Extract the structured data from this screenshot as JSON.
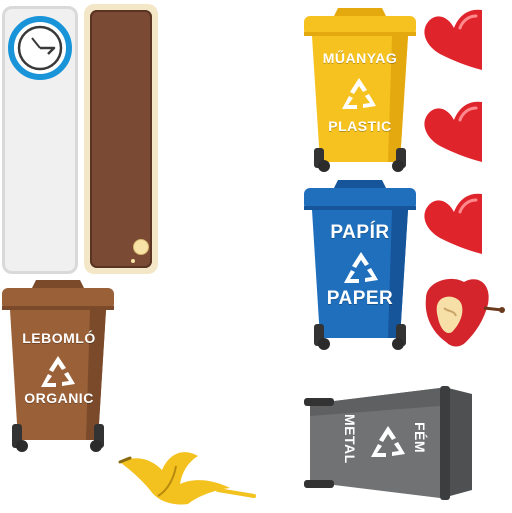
{
  "colors": {
    "plastic": "#f6c220",
    "paper": "#1f6fbd",
    "organic": "#9a6038",
    "metal": "#6f7172",
    "heart": "#e0242c"
  },
  "bins": {
    "plastic": {
      "line1": "MŰANYAG",
      "line2": "PLASTIC"
    },
    "paper": {
      "line1": "PAPÍR",
      "line2": "PAPER"
    },
    "organic": {
      "line1": "LEBOMLÓ",
      "line2": "ORGANIC"
    },
    "metal": {
      "line1": "FÉM",
      "line2": "METAL"
    }
  },
  "hud": {
    "timer_icon": "clock-icon",
    "progress_fraction": 1.0,
    "lives_total": 3
  },
  "items": {
    "waste_1": "banana-peel",
    "waste_2": "apple-core"
  }
}
